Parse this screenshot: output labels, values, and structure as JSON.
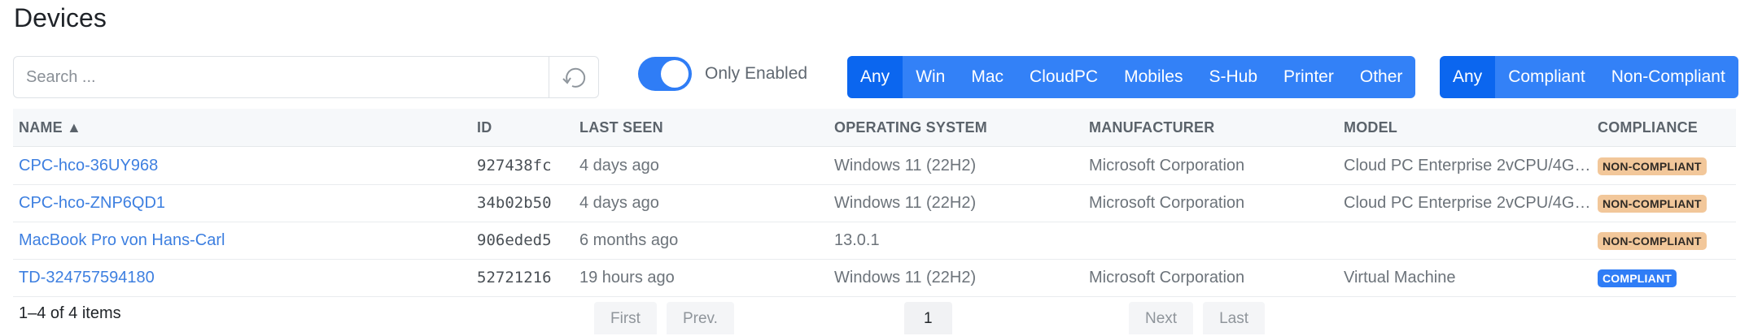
{
  "page": {
    "title": "Devices"
  },
  "toolbar": {
    "search_placeholder": "Search ...",
    "refresh_icon": "refresh-icon",
    "only_enabled_label": "Only Enabled",
    "only_enabled_on": true,
    "os_filters": [
      {
        "label": "Any",
        "active": true
      },
      {
        "label": "Win",
        "active": false
      },
      {
        "label": "Mac",
        "active": false
      },
      {
        "label": "CloudPC",
        "active": false
      },
      {
        "label": "Mobiles",
        "active": false
      },
      {
        "label": "S-Hub",
        "active": false
      },
      {
        "label": "Printer",
        "active": false
      },
      {
        "label": "Other",
        "active": false
      }
    ],
    "compliance_filters": [
      {
        "label": "Any",
        "active": true
      },
      {
        "label": "Compliant",
        "active": false
      },
      {
        "label": "Non-Compliant",
        "active": false
      }
    ],
    "accent_color": "#2f7df6"
  },
  "table": {
    "columns": {
      "name": "NAME ▲",
      "id": "ID",
      "last_seen": "LAST SEEN",
      "os": "OPERATING SYSTEM",
      "manufacturer": "MANUFACTURER",
      "model": "MODEL",
      "compliance": "COMPLIANCE"
    },
    "rows": [
      {
        "name": "CPC-hco-36UY968",
        "id": "927438fc",
        "last_seen": "4 days ago",
        "os": "Windows 11 (22H2)",
        "manufacturer": "Microsoft Corporation",
        "model": "Cloud PC Enterprise 2vCPU/4G…",
        "compliance": "NON-COMPLIANT"
      },
      {
        "name": "CPC-hco-ZNP6QD1",
        "id": "34b02b50",
        "last_seen": "4 days ago",
        "os": "Windows 11 (22H2)",
        "manufacturer": "Microsoft Corporation",
        "model": "Cloud PC Enterprise 2vCPU/4G…",
        "compliance": "NON-COMPLIANT"
      },
      {
        "name": "MacBook Pro von Hans-Carl",
        "id": "906eded5",
        "last_seen": "6 months ago",
        "os": "13.0.1",
        "manufacturer": "",
        "model": "",
        "compliance": "NON-COMPLIANT"
      },
      {
        "name": "TD-324757594180",
        "id": "52721216",
        "last_seen": "19 hours ago",
        "os": "Windows 11 (22H2)",
        "manufacturer": "Microsoft Corporation",
        "model": "Virtual Machine",
        "compliance": "COMPLIANT"
      }
    ]
  },
  "footer": {
    "item_count": "1–4 of 4 items",
    "pager": {
      "first": "First",
      "prev": "Prev.",
      "current": "1",
      "next": "Next",
      "last": "Last"
    }
  }
}
